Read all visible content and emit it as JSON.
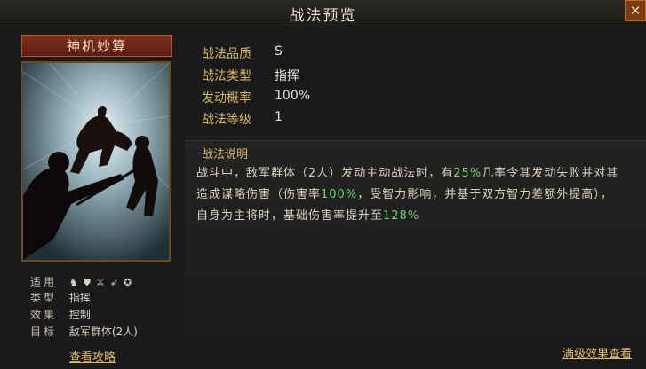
{
  "window": {
    "title": "战法预览",
    "close_label": "✕"
  },
  "card": {
    "name": "神机妙算",
    "info": [
      {
        "label": "适用",
        "icons": [
          "cavalry-icon",
          "shield-icon",
          "crossed-swords-icon",
          "spear-icon",
          "wheel-icon"
        ]
      },
      {
        "label": "类型",
        "value": "指挥"
      },
      {
        "label": "效果",
        "value": "控制"
      },
      {
        "label": "目标",
        "value": "敌军群体(2人)"
      }
    ],
    "guide_link": "查看攻略"
  },
  "stats": [
    {
      "label": "战法品质",
      "value": "S"
    },
    {
      "label": "战法类型",
      "value": "指挥"
    },
    {
      "label": "发动概率",
      "value": "100%"
    },
    {
      "label": "战法等级",
      "value": "1"
    }
  ],
  "description": {
    "title": "战法说明",
    "line1_a": "战斗中，敌军群体（2人）发动主动战法时，有",
    "line1_hl": "25%",
    "line1_b": "几率令其发动失败并对其",
    "line2_a": "造成谋略伤害（伤害率",
    "line2_hl": "100%",
    "line2_b": "，受智力影响，并基于双方智力差额外提高），",
    "line3_a": "自身为主将时，基础伤害率提升至",
    "line3_hl": "128%"
  },
  "full_effect_link": "满级效果查看",
  "colors": {
    "accent": "#d9b56a",
    "highlight": "#6fd36f"
  }
}
